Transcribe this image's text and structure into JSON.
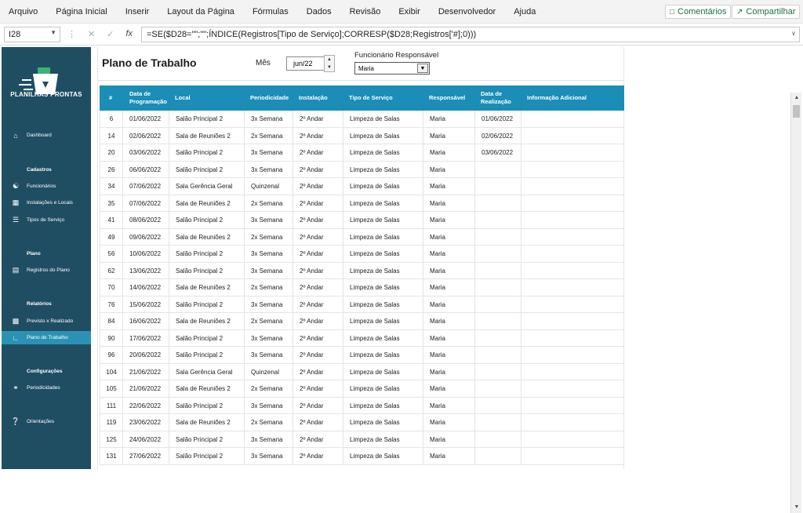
{
  "ribbon": {
    "menu": [
      "Arquivo",
      "Página Inicial",
      "Inserir",
      "Layout da Página",
      "Fórmulas",
      "Dados",
      "Revisão",
      "Exibir",
      "Desenvolvedor",
      "Ajuda"
    ],
    "comments_label": "Comentários",
    "share_label": "Compartilhar"
  },
  "formula_bar": {
    "cell_ref": "I28",
    "formula": "=SE($D28=\"\";\"\";ÍNDICE(Registros[Tipo de Serviço];CORRESP($D28;Registros['#];0)))"
  },
  "sidebar": {
    "logo_text": "PLANILHAS PRONTAS",
    "dashboard": "Dashboard",
    "cadastros_title": "Cadastros",
    "funcionarios": "Funcionários",
    "instalacoes": "Instalações e Locais",
    "tipos": "Tipos de Serviço",
    "plano_title": "Plano",
    "registros": "Registros do Plano",
    "relatorios_title": "Relatórios",
    "previsto": "Previsto x Realizado",
    "plano_trabalho": "Plano de Trabalho",
    "config_title": "Configurações",
    "periodicidades": "Periodicidades",
    "orientacoes": "Orientações"
  },
  "page": {
    "title": "Plano de Trabalho",
    "mes_label": "Mês",
    "mes_value": "jun/22",
    "func_label": "Funcionário Responsável",
    "func_value": "Maria"
  },
  "table": {
    "headers": [
      "#",
      "Data de Programação",
      "Local",
      "Periodicidade",
      "Instalação",
      "Tipo de Serviço",
      "Responsável",
      "Data de Realização",
      "Informação Adicional"
    ],
    "rows": [
      [
        "6",
        "01/06/2022",
        "Salão Principal 2",
        "3x Semana",
        "2º Andar",
        "Limpeza de Salas",
        "Maria",
        "01/06/2022",
        ""
      ],
      [
        "14",
        "02/06/2022",
        "Sala de Reuniões 2",
        "2x Semana",
        "2º Andar",
        "Limpeza de Salas",
        "Maria",
        "02/06/2022",
        ""
      ],
      [
        "20",
        "03/06/2022",
        "Salão Principal 2",
        "3x Semana",
        "2º Andar",
        "Limpeza de Salas",
        "Maria",
        "03/06/2022",
        ""
      ],
      [
        "26",
        "06/06/2022",
        "Salão Principal 2",
        "3x Semana",
        "2º Andar",
        "Limpeza de Salas",
        "Maria",
        "",
        ""
      ],
      [
        "34",
        "07/06/2022",
        "Sala Gerência Geral",
        "Quinzenal",
        "2º Andar",
        "Limpeza de Salas",
        "Maria",
        "",
        ""
      ],
      [
        "35",
        "07/06/2022",
        "Sala de Reuniões 2",
        "2x Semana",
        "2º Andar",
        "Limpeza de Salas",
        "Maria",
        "",
        ""
      ],
      [
        "41",
        "08/06/2022",
        "Salão Principal 2",
        "3x Semana",
        "2º Andar",
        "Limpeza de Salas",
        "Maria",
        "",
        ""
      ],
      [
        "49",
        "09/06/2022",
        "Sala de Reuniões 2",
        "2x Semana",
        "2º Andar",
        "Limpeza de Salas",
        "Maria",
        "",
        ""
      ],
      [
        "56",
        "10/06/2022",
        "Salão Principal 2",
        "3x Semana",
        "2º Andar",
        "Limpeza de Salas",
        "Maria",
        "",
        ""
      ],
      [
        "62",
        "13/06/2022",
        "Salão Principal 2",
        "3x Semana",
        "2º Andar",
        "Limpeza de Salas",
        "Maria",
        "",
        ""
      ],
      [
        "70",
        "14/06/2022",
        "Sala de Reuniões 2",
        "2x Semana",
        "2º Andar",
        "Limpeza de Salas",
        "Maria",
        "",
        ""
      ],
      [
        "76",
        "15/06/2022",
        "Salão Principal 2",
        "3x Semana",
        "2º Andar",
        "Limpeza de Salas",
        "Maria",
        "",
        ""
      ],
      [
        "84",
        "16/06/2022",
        "Sala de Reuniões 2",
        "2x Semana",
        "2º Andar",
        "Limpeza de Salas",
        "Maria",
        "",
        ""
      ],
      [
        "90",
        "17/06/2022",
        "Salão Principal 2",
        "3x Semana",
        "2º Andar",
        "Limpeza de Salas",
        "Maria",
        "",
        ""
      ],
      [
        "96",
        "20/06/2022",
        "Salão Principal 2",
        "3x Semana",
        "2º Andar",
        "Limpeza de Salas",
        "Maria",
        "",
        ""
      ],
      [
        "104",
        "21/06/2022",
        "Sala Gerência Geral",
        "Quinzenal",
        "2º Andar",
        "Limpeza de Salas",
        "Maria",
        "",
        ""
      ],
      [
        "105",
        "21/06/2022",
        "Sala de Reuniões 2",
        "2x Semana",
        "2º Andar",
        "Limpeza de Salas",
        "Maria",
        "",
        ""
      ],
      [
        "111",
        "22/06/2022",
        "Salão Principal 2",
        "3x Semana",
        "2º Andar",
        "Limpeza de Salas",
        "Maria",
        "",
        ""
      ],
      [
        "119",
        "23/06/2022",
        "Sala de Reuniões 2",
        "2x Semana",
        "2º Andar",
        "Limpeza de Salas",
        "Maria",
        "",
        ""
      ],
      [
        "125",
        "24/06/2022",
        "Salão Principal 2",
        "3x Semana",
        "2º Andar",
        "Limpeza de Salas",
        "Maria",
        "",
        ""
      ],
      [
        "131",
        "27/06/2022",
        "Salão Principal 2",
        "3x Semana",
        "2º Andar",
        "Limpeza de Salas",
        "Maria",
        "",
        ""
      ]
    ]
  },
  "colors": {
    "sidebar_bg": "#1f4e63",
    "active_item": "#2b92b4",
    "table_header": "#1b8db6",
    "accent_green": "#1e6f41"
  }
}
